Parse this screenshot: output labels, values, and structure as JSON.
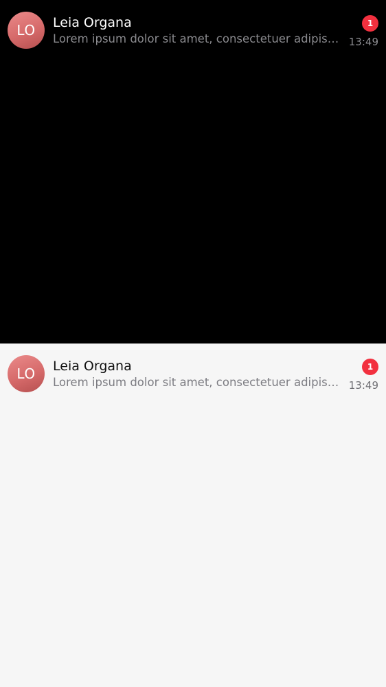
{
  "conversations": [
    {
      "theme": "dark",
      "initials": "LO",
      "name": "Leia Organa",
      "preview": "Lorem ipsum dolor sit amet, consectetuer adipiscing elit.",
      "unread": "1",
      "time": "13:49"
    },
    {
      "theme": "light",
      "initials": "LO",
      "name": "Leia Organa",
      "preview": "Lorem ipsum dolor sit amet, consectetuer adipiscing elit.",
      "unread": "1",
      "time": "13:49"
    }
  ],
  "colors": {
    "dark_background": "#000000",
    "light_background": "#f6f6f6",
    "badge": "#f2303f",
    "avatar": "#d66a6a"
  }
}
